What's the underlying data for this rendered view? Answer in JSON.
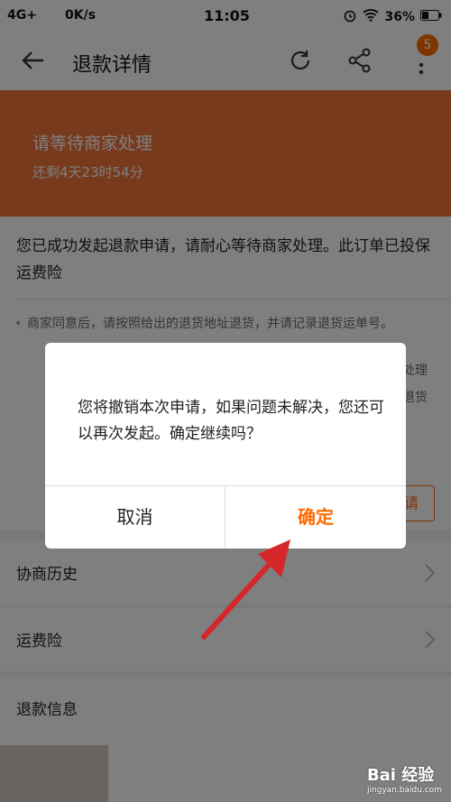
{
  "status_bar": {
    "signal": "4G+",
    "speed": "0K/s",
    "time": "11:05",
    "battery": "36%",
    "icons": [
      "alarm-icon",
      "wifi-icon",
      "battery-icon"
    ]
  },
  "toolbar": {
    "title": "退款详情",
    "badge_count": "5",
    "icons": [
      "back-arrow-icon",
      "refresh-icon",
      "share-icon",
      "more-icon"
    ]
  },
  "banner": {
    "title": "请等待商家处理",
    "subtitle": "还剩4天23时54分",
    "color": "#f0743a"
  },
  "main": {
    "message": "您已成功发起退款申请，请耐心等待商家处理。此订单已投保运费险",
    "tips": [
      "商家同意后，请按照给出的退货地址退货，并请记录退货运单号。",
      "处理",
      "退货"
    ],
    "partial_button_label": "请",
    "rows": [
      {
        "label": "协商历史"
      },
      {
        "label": "运费险"
      },
      {
        "label": "退款信息"
      }
    ]
  },
  "dialog": {
    "message": "您将撤销本次申请，如果问题未解决，您还可以再次发起。确定继续吗？",
    "cancel_label": "取消",
    "confirm_label": "确定",
    "accent": "#ff6a00"
  },
  "watermark": {
    "brand": "Bai 经验",
    "url": "jingyan.baidu.com"
  }
}
